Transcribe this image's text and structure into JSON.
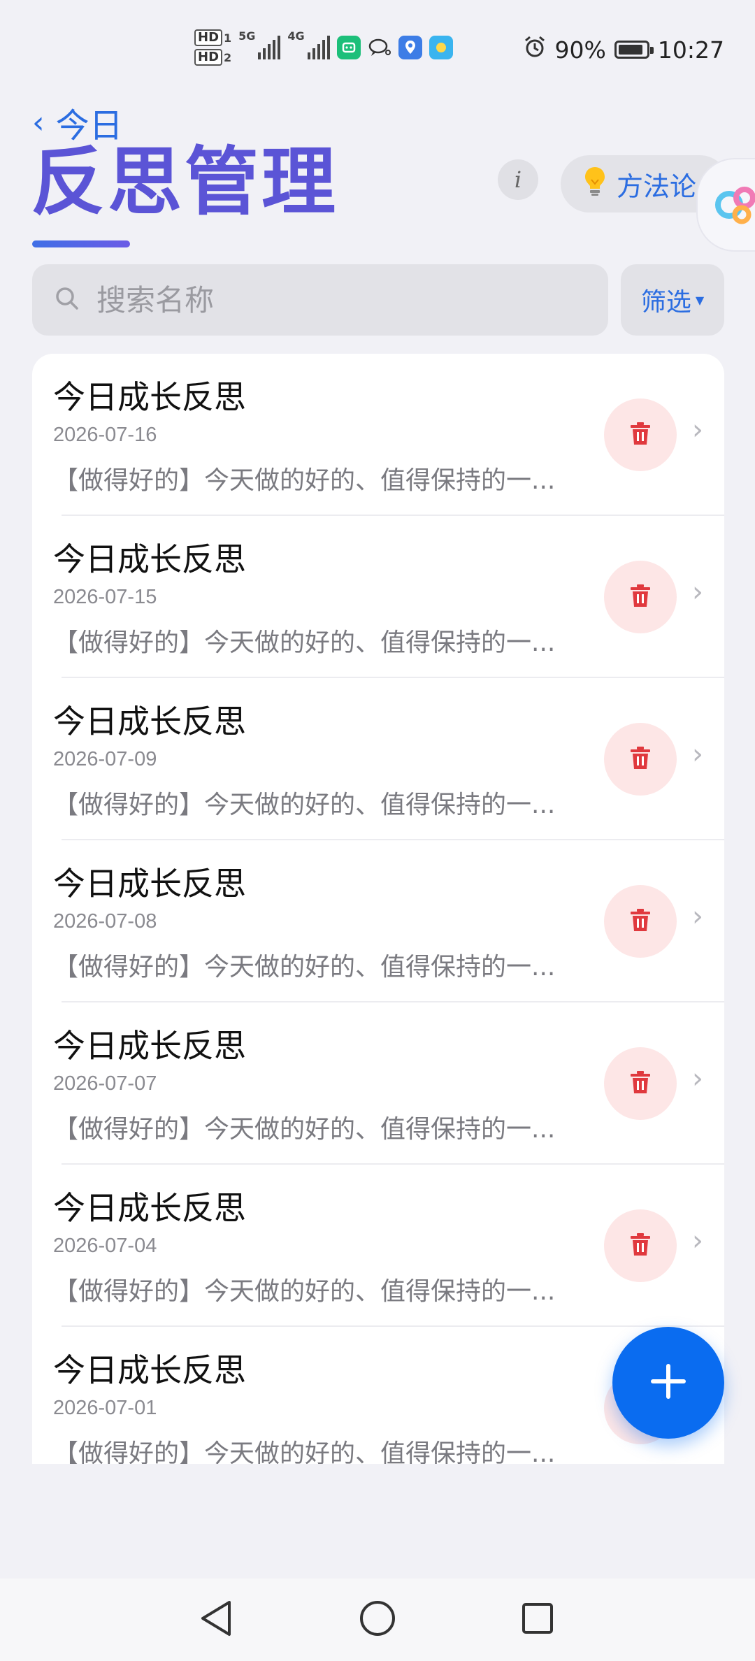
{
  "status_bar": {
    "hd1": "HD",
    "hd1_index": "1",
    "hd2": "HD",
    "hd2_index": "2",
    "net1": "5G",
    "net2": "4G",
    "battery_text": "90%",
    "battery_level": 0.9,
    "time": "10:27"
  },
  "header": {
    "back_label": "今日",
    "title": "反思管理",
    "info_label": "i",
    "method_label": "方法论"
  },
  "search": {
    "placeholder": "搜索名称",
    "value": ""
  },
  "filter": {
    "label": "筛选"
  },
  "reflections": [
    {
      "title": "今日成长反思",
      "date": "2026-07-16",
      "preview": "【做得好的】今天做的好的、值得保持的一..."
    },
    {
      "title": "今日成长反思",
      "date": "2026-07-15",
      "preview": "【做得好的】今天做的好的、值得保持的一..."
    },
    {
      "title": "今日成长反思",
      "date": "2026-07-09",
      "preview": "【做得好的】今天做的好的、值得保持的一..."
    },
    {
      "title": "今日成长反思",
      "date": "2026-07-08",
      "preview": "【做得好的】今天做的好的、值得保持的一..."
    },
    {
      "title": "今日成长反思",
      "date": "2026-07-07",
      "preview": "【做得好的】今天做的好的、值得保持的一..."
    },
    {
      "title": "今日成长反思",
      "date": "2026-07-04",
      "preview": "【做得好的】今天做的好的、值得保持的一..."
    },
    {
      "title": "今日成长反思",
      "date": "2026-07-01",
      "preview": "【做得好的】今天做的好的、值得保持的一..."
    }
  ],
  "colors": {
    "accent": "#2b6de1",
    "title": "#5b54d6",
    "fab": "#0a6cf0",
    "delete_icon": "#e0393e",
    "delete_bg": "#fde6e6"
  },
  "icons": {
    "back": "chevron-left-icon",
    "method": "lightbulb-icon",
    "search": "search-icon",
    "filter": "caret-down-icon",
    "delete": "trash-icon",
    "row": "chevron-right-icon",
    "fab": "plus-icon",
    "nav": [
      "back-triangle-icon",
      "home-circle-icon",
      "recents-square-icon"
    ]
  }
}
